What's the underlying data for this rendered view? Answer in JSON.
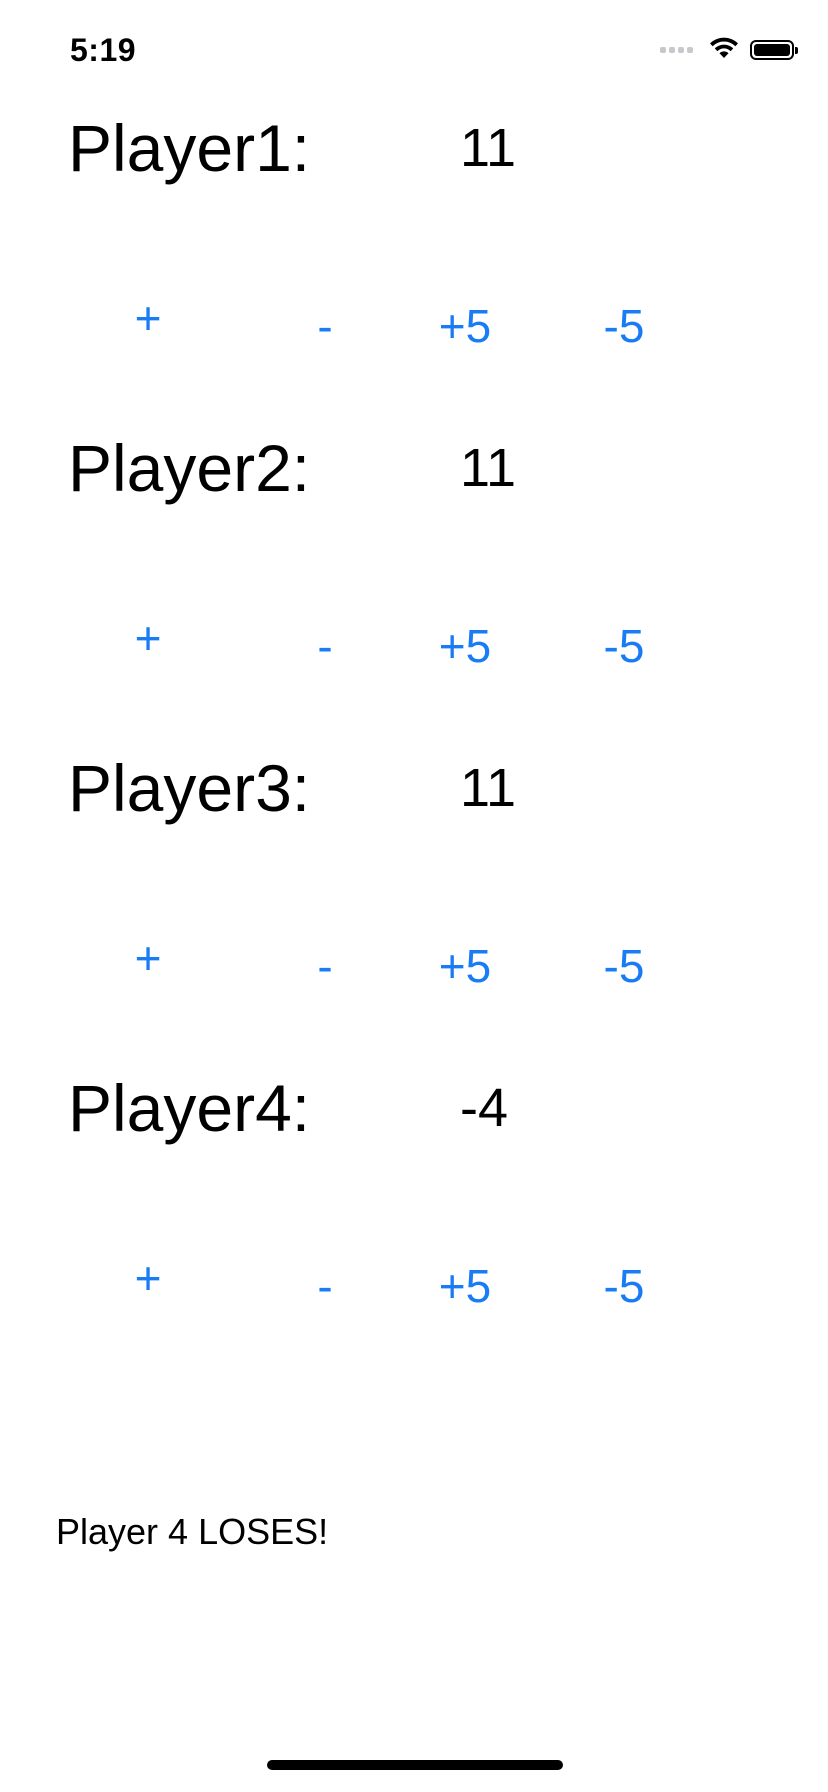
{
  "status_bar": {
    "time": "5:19"
  },
  "players": [
    {
      "name": "Player1:",
      "score": "11",
      "buttons": {
        "plus": "+",
        "minus": "-",
        "plus5": "+5",
        "minus5": "-5"
      }
    },
    {
      "name": "Player2:",
      "score": "11",
      "buttons": {
        "plus": "+",
        "minus": "-",
        "plus5": "+5",
        "minus5": "-5"
      }
    },
    {
      "name": "Player3:",
      "score": "11",
      "buttons": {
        "plus": "+",
        "minus": "-",
        "plus5": "+5",
        "minus5": "-5"
      }
    },
    {
      "name": "Player4:",
      "score": "-4",
      "buttons": {
        "plus": "+",
        "minus": "-",
        "plus5": "+5",
        "minus5": "-5"
      }
    }
  ],
  "result": {
    "message": "Player 4 LOSES!"
  },
  "colors": {
    "button_accent": "#1a7cf5",
    "text": "#000000",
    "background": "#ffffff"
  },
  "icons": {
    "signal": "cellular-signal-icon",
    "wifi": "wifi-icon",
    "battery": "battery-icon"
  }
}
